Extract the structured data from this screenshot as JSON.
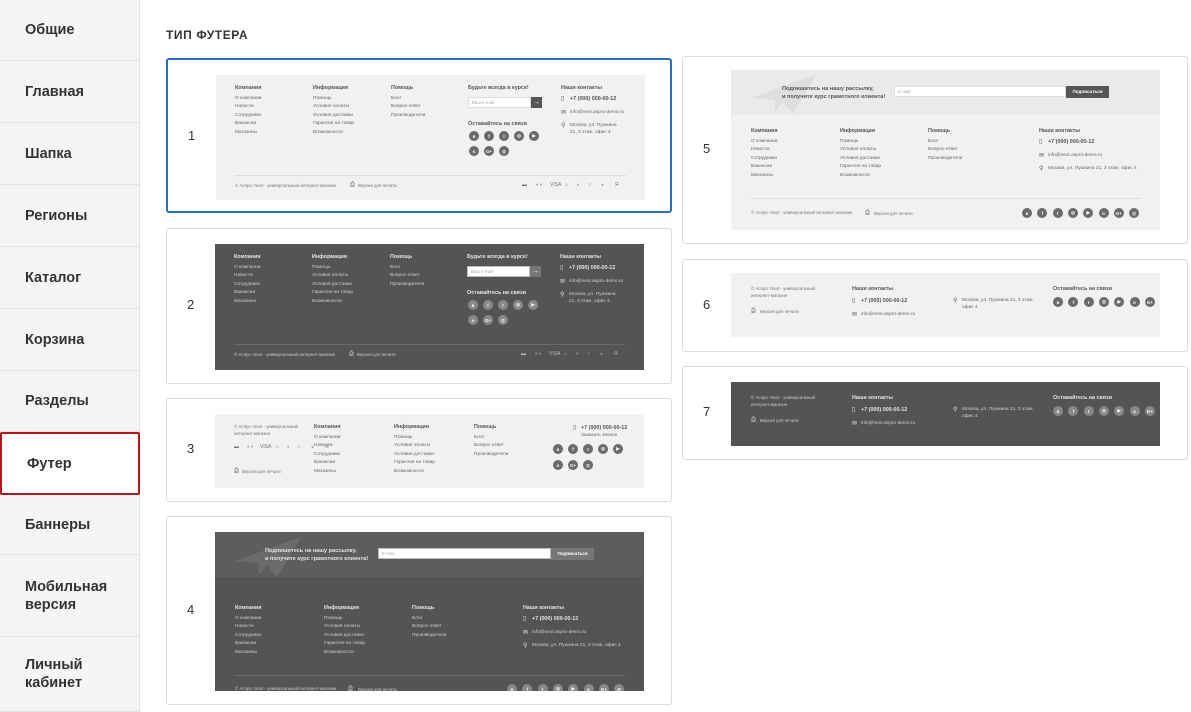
{
  "sidebar": {
    "items": [
      {
        "label": "Общие"
      },
      {
        "label": "Главная"
      },
      {
        "label": "Шапка"
      },
      {
        "label": "Регионы"
      },
      {
        "label": "Каталог"
      },
      {
        "label": "Корзина"
      },
      {
        "label": "Разделы"
      },
      {
        "label": "Футер",
        "active": true
      },
      {
        "label": "Баннеры"
      },
      {
        "label": "Мобильная версия"
      },
      {
        "label": "Личный кабинет"
      }
    ]
  },
  "section_title": "ТИП ФУТЕРА",
  "options": [
    {
      "number": "1",
      "theme": "light",
      "selected": true
    },
    {
      "number": "2",
      "theme": "dark"
    },
    {
      "number": "3",
      "theme": "light"
    },
    {
      "number": "4",
      "theme": "dark"
    },
    {
      "number": "5",
      "theme": "light"
    },
    {
      "number": "6",
      "theme": "light"
    },
    {
      "number": "7",
      "theme": "dark"
    }
  ],
  "footer": {
    "company": {
      "title": "Компания",
      "links": [
        "О компании",
        "Новости",
        "Сотрудники",
        "Вакансии",
        "Магазины"
      ]
    },
    "info": {
      "title": "Информация",
      "links": [
        "Помощь",
        "Условия оплаты",
        "Условия доставки",
        "Гарантия на товар",
        "Возможности"
      ]
    },
    "help": {
      "title": "Помощь",
      "links": [
        "Блог",
        "Вопрос-ответ",
        "Производители"
      ]
    },
    "news_title": "Будьте всегда в курсе!",
    "email_placeholder": "Ваш e-mail",
    "email_placeholder_short": "E-mail",
    "social_title": "Оставайтесь на связи",
    "contacts_title": "Наши контакты",
    "phone": "+7 (000) 000-00-12",
    "callback": "Заказать звонок",
    "email": "info@next.aspro-demo.ru",
    "address": "Москва, ул. Пушкина 21, 3 этаж, офис 4",
    "address_line1": "Москва, ул. Пушкина",
    "address_line2": "21, 3 этаж, офис 4",
    "address_a": "Москва, ул. Пушкина 21, 3 этаж,",
    "address_b": "офис 4",
    "copyright": "© Аспро: Next - универсальный интернет-магазин",
    "copyright_a": "© Аспро: Next - универсальный",
    "copyright_b": "интернет-магазин",
    "print_version": "Версия для печати",
    "subscribe_line1": "Подпишитесь на нашу рассылку,",
    "subscribe_line2": "и получите курс грамотного клиента!",
    "subscribe_button": "Подписаться",
    "social_icons": [
      "vk-icon",
      "facebook-icon",
      "twitter-icon",
      "instagram-icon",
      "youtube-icon",
      "odnoklassniki-icon",
      "google-plus-icon",
      "mail-icon"
    ],
    "payment_icons": [
      "card-icon",
      "mastercard-icon",
      "visa-icon",
      "bank-icon",
      "pay-icon",
      "qiwi-icon",
      "wallet-icon",
      "yandex-icon"
    ]
  }
}
